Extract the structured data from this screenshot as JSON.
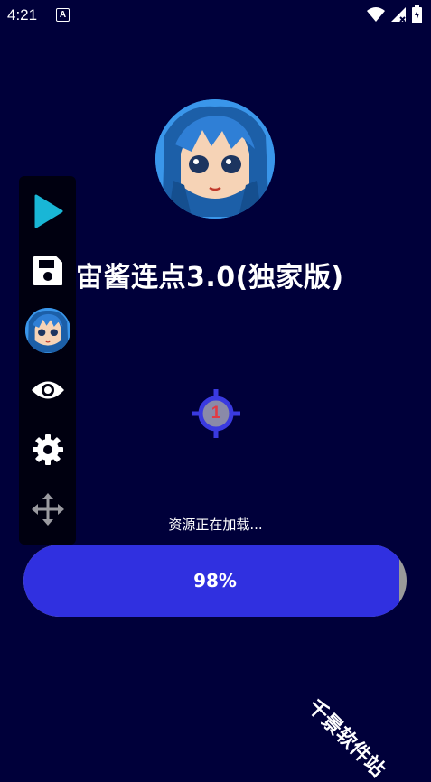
{
  "status_bar": {
    "time": "4:21",
    "notification_icon": "a-icon",
    "icons": [
      "wifi-icon",
      "signal-icon",
      "battery-icon"
    ]
  },
  "app": {
    "title": "宙酱连点3.0(独家版)",
    "avatar_icon": "anime-avatar-icon"
  },
  "floating_toolbar": {
    "items": [
      "play-icon",
      "save-icon",
      "avatar-icon",
      "eye-icon",
      "gear-icon",
      "move-icon"
    ]
  },
  "click_target": {
    "number": "1"
  },
  "loading": {
    "text": "资源正在加载...",
    "progress_label": "98%",
    "progress_fraction": 0.98
  },
  "watermark": {
    "text": "千景软件站"
  },
  "colors": {
    "background": "#00003a",
    "progress_fill": "#3030e0",
    "progress_track": "#9a9a9a",
    "play_accent": "#19b6d6",
    "target_ring": "#3a3ae0",
    "target_number": "#e23a43"
  }
}
